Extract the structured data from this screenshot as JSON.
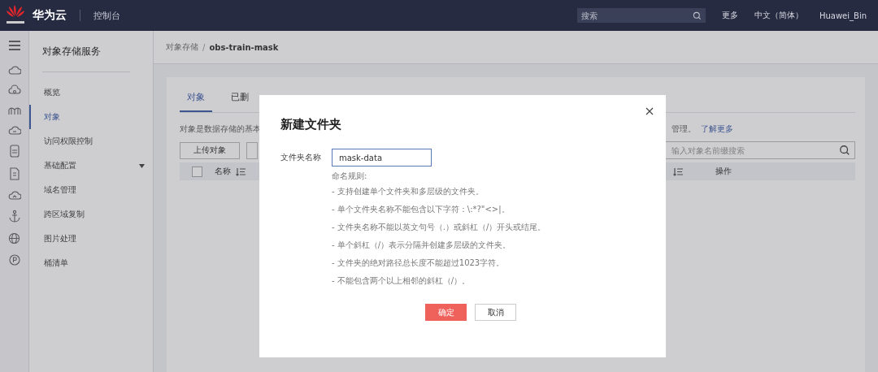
{
  "topbar": {
    "brand": "华为云",
    "console": "控制台",
    "search": {
      "placeholder": "搜索"
    },
    "links": [
      "更多",
      "中文（简体）",
      "Huawei_Bin"
    ]
  },
  "sidebar": {
    "title": "对象存储服务",
    "items": [
      {
        "label": "概览",
        "selected": false,
        "kind": "item"
      },
      {
        "label": "对象",
        "selected": true,
        "kind": "item"
      },
      {
        "label": "访问权限控制",
        "selected": false,
        "kind": "item"
      },
      {
        "label": "基础配置",
        "selected": false,
        "kind": "group"
      },
      {
        "label": "域名管理",
        "selected": false,
        "kind": "item"
      },
      {
        "label": "跨区域复制",
        "selected": false,
        "kind": "item"
      },
      {
        "label": "图片处理",
        "selected": false,
        "kind": "item"
      },
      {
        "label": "桶清单",
        "selected": false,
        "kind": "item"
      }
    ]
  },
  "breadcrumb": {
    "items": [
      "对象存储",
      "obs-train-mask"
    ],
    "separator": "/"
  },
  "tabs": [
    {
      "label": "对象",
      "selected": true
    },
    {
      "label": "已删",
      "selected": false
    }
  ],
  "description": {
    "text": "对象是数据存储的基本",
    "tail": "管理。",
    "link": "了解更多"
  },
  "toolbar": {
    "buttons": [
      "上传对象"
    ],
    "search": {
      "placeholder": "输入对象名前缀搜索"
    }
  },
  "table": {
    "select_all_checked": false,
    "columns": [
      "名称",
      "操作"
    ]
  },
  "dialog": {
    "title": "新建文件夹",
    "field_label": "文件夹名称",
    "value": "mask-data",
    "rules_title": "命名规则:",
    "rules": [
      "- 支持创建单个文件夹和多层级的文件夹。",
      "- 单个文件夹名称不能包含以下字符：\\:*?\"<>|。",
      "- 文件夹名称不能以英文句号（.）或斜杠（/）开头或结尾。",
      "- 单个斜杠（/）表示分隔并创建多层级的文件夹。",
      "- 文件夹的绝对路径总长度不能超过1023字符。",
      "- 不能包含两个以上相邻的斜杠（/）。"
    ],
    "confirm": "确定",
    "cancel": "取消"
  }
}
